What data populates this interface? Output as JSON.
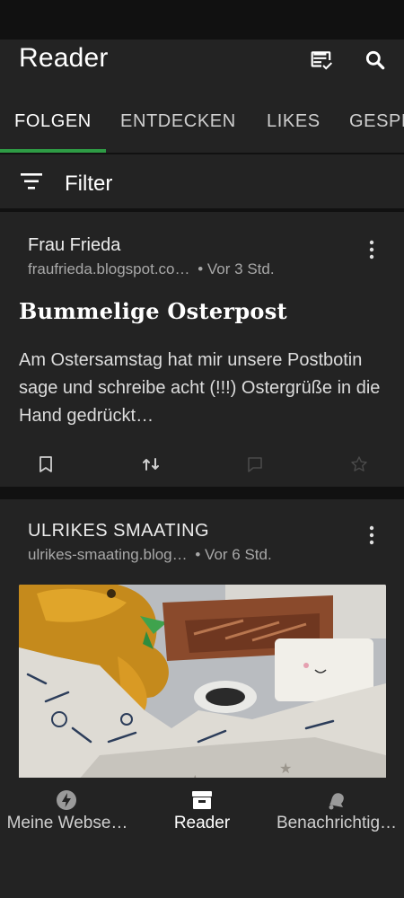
{
  "app": {
    "title": "Reader"
  },
  "tabs": [
    {
      "label": "FOLGEN"
    },
    {
      "label": "ENTDECKEN"
    },
    {
      "label": "LIKES"
    },
    {
      "label": "GESPEICHERT"
    }
  ],
  "filter": {
    "label": "Filter"
  },
  "posts": [
    {
      "site_name": "Frau Frieda",
      "site_url": "fraufrieda.blogspot.co…",
      "time": "• Vor 3 Std.",
      "title": "Bummelige Osterpost",
      "excerpt": "Am Ostersamstag hat mir unsere Postbotin sage und schreibe acht (!!!) Ostergrüße in die Hand gedrückt…"
    },
    {
      "site_name": "ULRIKES SMAATING",
      "site_url": "ulrikes-smaating.blog…",
      "time": "• Vor 6 Std."
    }
  ],
  "bottom_nav": [
    {
      "label": "Meine Webseite",
      "display": "Meine Webse…"
    },
    {
      "label": "Reader",
      "display": "Reader"
    },
    {
      "label": "Benachrichtigungen",
      "display": "Benachrichtig…"
    }
  ],
  "colors": {
    "surface": "#232323",
    "background": "#111111",
    "accent": "#2e9b45"
  },
  "icons": {
    "app_bar": [
      "manage-subscriptions-icon",
      "search-icon"
    ],
    "filter": "filter-icon",
    "card_actions": [
      "bookmark-icon",
      "reblog-icon",
      "comment-icon",
      "star-icon"
    ],
    "card_menu": "more-vertical-icon",
    "bottom_nav": [
      "my-site-icon",
      "reader-icon",
      "notifications-icon"
    ]
  }
}
